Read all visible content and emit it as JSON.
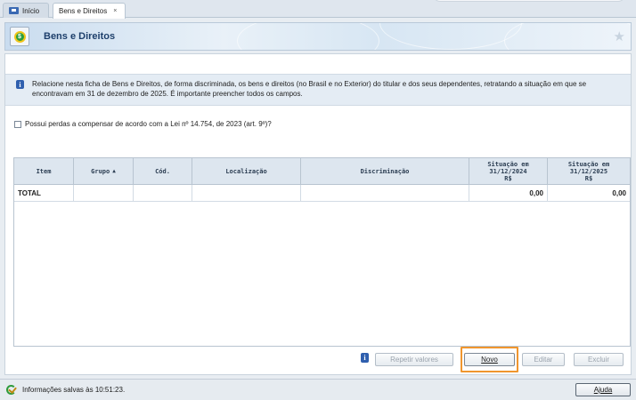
{
  "tabs": [
    {
      "label": "Início",
      "icon": "home-icon"
    },
    {
      "label": "Bens e Direitos",
      "close": "×"
    }
  ],
  "header": {
    "title": "Bens e Direitos",
    "icon": "money-coin-icon"
  },
  "info": {
    "text": "Relacione nesta ficha de Bens e Direitos, de forma discriminada, os bens e direitos (no Brasil e no Exterior) do titular e dos seus dependentes, retratando a situação em que se encontravam em 31 de dezembro de 2025. É importante preencher todos os campos."
  },
  "checkbox": {
    "label": "Possui perdas a compensar de acordo com a Lei nº 14.754, de 2023 (art. 9º)?",
    "checked": false
  },
  "table": {
    "columns": [
      "Item",
      "Grupo",
      "Cód.",
      "Localização",
      "Discriminação",
      "Situação em 31/12/2024 R$",
      "Situação em 31/12/2025 R$"
    ],
    "sort_indicator": "▲",
    "total_row": {
      "label": "TOTAL",
      "value_2024": "0,00",
      "value_2025": "0,00"
    }
  },
  "buttons": {
    "repeat": "Repetir valores",
    "new": "Novo",
    "edit": "Editar",
    "delete": "Excluir",
    "help": "Ajuda"
  },
  "status": {
    "text": "Informações salvas às 10:51:23."
  },
  "colors": {
    "accent": "#f0962e",
    "header_text": "#1d3f6b",
    "info_icon": "#2f5fae"
  }
}
